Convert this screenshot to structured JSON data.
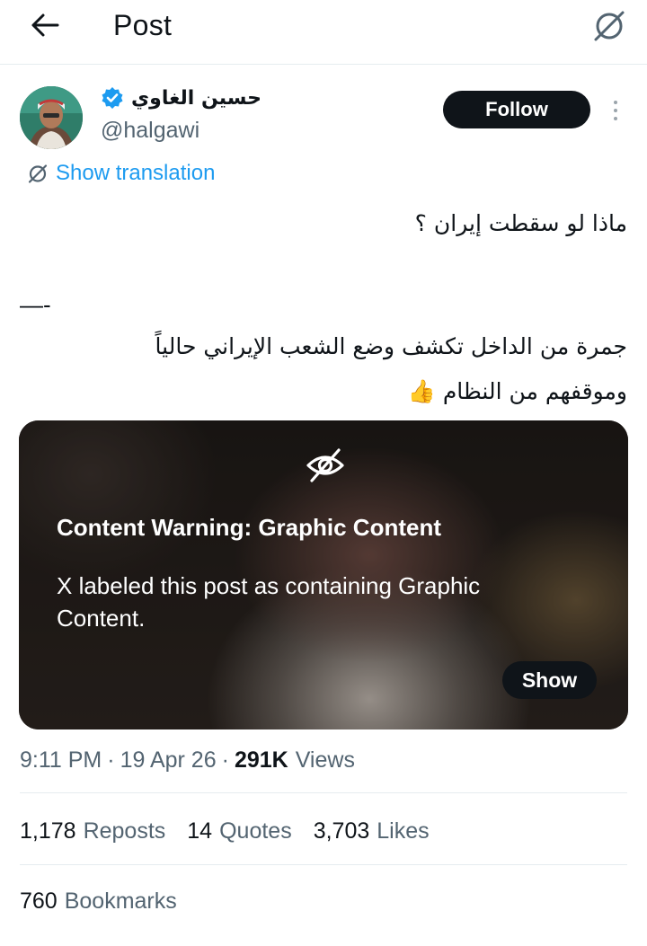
{
  "header": {
    "title": "Post",
    "back_icon": "arrow-left-icon",
    "translate_icon": "translate-off-icon"
  },
  "author": {
    "name": "حسين الغاوي",
    "handle": "@halgawi",
    "verified": true,
    "verified_color": "#1d9bf0",
    "follow_label": "Follow"
  },
  "translation": {
    "label": "Show translation"
  },
  "tweet": {
    "line1": "ماذا لو سقطت إيران ؟",
    "dash": "—-",
    "line2": "جمرة من الداخل تكشف وضع الشعب الإيراني حالياً",
    "line3": "وموقفهم من النظام 👍"
  },
  "media_warning": {
    "title": "Content Warning: Graphic Content",
    "body": "X labeled this post as containing Graphic Content.",
    "show_label": "Show",
    "icon": "eye-slash-icon"
  },
  "meta": {
    "time": "9:11 PM",
    "date": "19 Apr 26",
    "views_count": "291K",
    "views_label": "Views",
    "separator": "·"
  },
  "stats": {
    "reposts_count": "1,178",
    "reposts_label": "Reposts",
    "quotes_count": "14",
    "quotes_label": "Quotes",
    "likes_count": "3,703",
    "likes_label": "Likes",
    "bookmarks_count": "760",
    "bookmarks_label": "Bookmarks"
  },
  "colors": {
    "text_primary": "#0f1419",
    "text_secondary": "#536471",
    "accent": "#1d9bf0",
    "divider": "#e6ecf0"
  }
}
